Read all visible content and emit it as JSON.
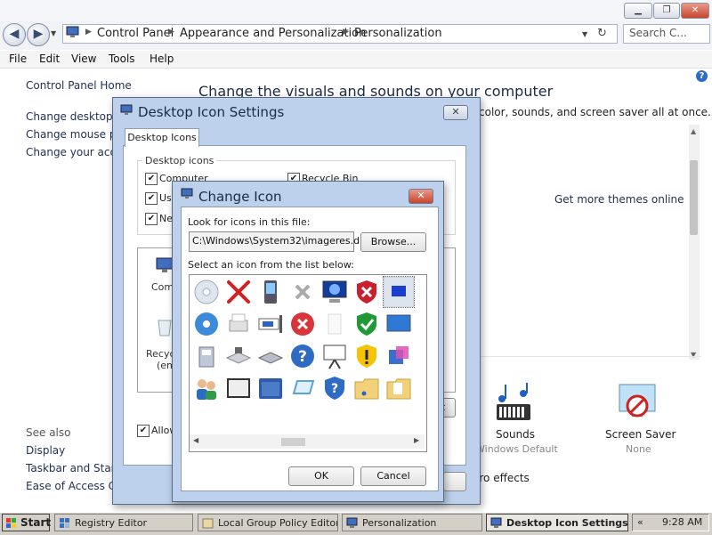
{
  "window": {
    "minimize": "▁",
    "restore": "❐",
    "close": "✕"
  },
  "address": {
    "back": "◀",
    "forward": "▶",
    "breadcrumb": [
      "Control Panel",
      "Appearance and Personalization",
      "Personalization"
    ],
    "search_placeholder": "Search C..."
  },
  "menu": [
    "File",
    "Edit",
    "View",
    "Tools",
    "Help"
  ],
  "sidebar": {
    "home": "Control Panel Home",
    "links": [
      "Change desktop i",
      "Change mouse po",
      "Change your acco"
    ],
    "see_also_title": "See also",
    "see_also": [
      "Display",
      "Taskbar and Star",
      "Ease of Access C"
    ]
  },
  "main": {
    "heading": "Change the visuals and sounds on your computer",
    "subtext": "color, sounds, and screen saver all at once.",
    "get_themes": "Get more themes online",
    "sounds_label": "Sounds",
    "sounds_value": "Windows Default",
    "saver_label": "Screen Saver",
    "saver_value": "None",
    "effects": "ero effects"
  },
  "desktop_icon_settings": {
    "title": "Desktop Icon Settings",
    "close": "✕",
    "tab": "Desktop Icons",
    "group": "Desktop icons",
    "checkboxes": [
      "Computer",
      "Us",
      "Ne"
    ],
    "recycle": "Recycle Bin",
    "preview_computer": "Comp",
    "preview_recycle": "Recyc",
    "preview_recycle2": "(em",
    "allow": "Allow",
    "lt": "lt"
  },
  "change_icon": {
    "title": "Change Icon",
    "close": "✕",
    "look_label": "Look for icons in this file:",
    "file_path": "C:\\Windows\\System32\\imageres.dll",
    "browse": "Browse...",
    "select_label": "Select an icon from the list below:",
    "ok": "OK",
    "cancel": "Cancel",
    "icons": [
      [
        "disc-icon",
        "red-x-icon",
        "pda-icon",
        "gray-x-icon",
        "monitor-icon",
        "shield-x-icon",
        "blue-screen-icon",
        "folder-partial-icon"
      ],
      [
        "dvd-icon",
        "printer-icon",
        "network-adapter-icon",
        "error-icon",
        "blank-page-icon",
        "shield-check-icon",
        "display-icon",
        "partial-icon"
      ],
      [
        "fax-icon",
        "scanner-icon",
        "drive-icon",
        "help-icon",
        "projector-icon",
        "shield-warning-icon",
        "cube-icon",
        "folder-icon"
      ],
      [
        "users-icon",
        "picture-frame-icon",
        "folder-blue-icon",
        "frame-icon",
        "shield-help-icon",
        "folder-music-icon",
        "folder-doc-icon",
        "partial-icon"
      ]
    ]
  },
  "taskbar": {
    "start": "Start",
    "tasks": [
      "Registry Editor",
      "Local Group Policy Editor",
      "Personalization",
      "Desktop Icon Settings"
    ],
    "time": "9:28 AM",
    "chevron": "«"
  },
  "colors": {
    "dialog_frame": "#bdd1ec",
    "link": "#1e2f4f",
    "shield_red": "#c8202c",
    "shield_green": "#1f9a36",
    "help_blue": "#2e6bc4"
  }
}
